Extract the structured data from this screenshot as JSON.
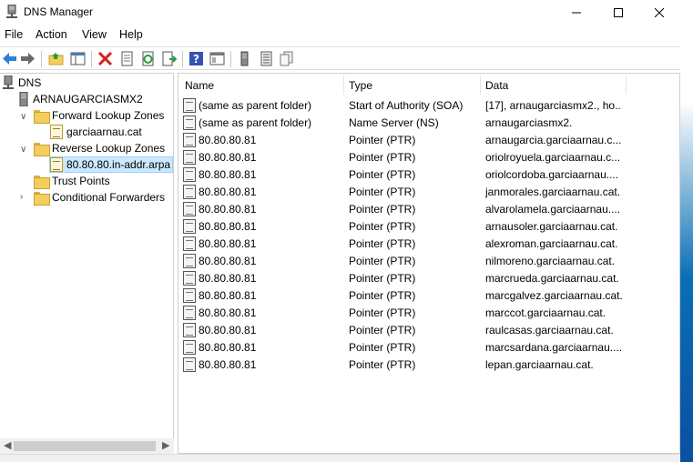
{
  "window": {
    "title": "DNS Manager"
  },
  "menu": [
    "File",
    "Action",
    "View",
    "Help"
  ],
  "toolbar_icons": [
    "back-icon",
    "forward-icon",
    "up-folder-icon",
    "show-hide-tree-icon",
    "delete-icon",
    "properties-icon",
    "refresh-icon",
    "export-icon",
    "help-icon",
    "mmc-icon",
    "server-icon",
    "list-icon",
    "copy-icon"
  ],
  "tree": {
    "root": "DNS",
    "server": "ARNAUGARCIASMX2",
    "forward": "Forward Lookup Zones",
    "forward_zone": "garciaarnau.cat",
    "reverse": "Reverse Lookup Zones",
    "reverse_zone": "80.80.80.in-addr.arpa",
    "trust": "Trust Points",
    "conditional": "Conditional Forwarders"
  },
  "columns": {
    "name": "Name",
    "type": "Type",
    "data": "Data"
  },
  "records": [
    {
      "name": "(same as parent folder)",
      "type": "Start of Authority (SOA)",
      "data": "[17], arnaugarciasmx2., ho..."
    },
    {
      "name": "(same as parent folder)",
      "type": "Name Server (NS)",
      "data": "arnaugarciasmx2."
    },
    {
      "name": "80.80.80.81",
      "type": "Pointer (PTR)",
      "data": "arnaugarcia.garciaarnau.c..."
    },
    {
      "name": "80.80.80.81",
      "type": "Pointer (PTR)",
      "data": "oriolroyuela.garciaarnau.c..."
    },
    {
      "name": "80.80.80.81",
      "type": "Pointer (PTR)",
      "data": "oriolcordoba.garciaarnau...."
    },
    {
      "name": "80.80.80.81",
      "type": "Pointer (PTR)",
      "data": "janmorales.garciaarnau.cat."
    },
    {
      "name": "80.80.80.81",
      "type": "Pointer (PTR)",
      "data": "alvarolamela.garciaarnau...."
    },
    {
      "name": "80.80.80.81",
      "type": "Pointer (PTR)",
      "data": "arnausoler.garciaarnau.cat."
    },
    {
      "name": "80.80.80.81",
      "type": "Pointer (PTR)",
      "data": "alexroman.garciaarnau.cat."
    },
    {
      "name": "80.80.80.81",
      "type": "Pointer (PTR)",
      "data": "nilmoreno.garciaarnau.cat."
    },
    {
      "name": "80.80.80.81",
      "type": "Pointer (PTR)",
      "data": "marcrueda.garciaarnau.cat."
    },
    {
      "name": "80.80.80.81",
      "type": "Pointer (PTR)",
      "data": "marcgalvez.garciaarnau.cat."
    },
    {
      "name": "80.80.80.81",
      "type": "Pointer (PTR)",
      "data": "marccot.garciaarnau.cat."
    },
    {
      "name": "80.80.80.81",
      "type": "Pointer (PTR)",
      "data": "raulcasas.garciaarnau.cat."
    },
    {
      "name": "80.80.80.81",
      "type": "Pointer (PTR)",
      "data": "marcsardana.garciaarnau...."
    },
    {
      "name": "80.80.80.81",
      "type": "Pointer (PTR)",
      "data": "lepan.garciaarnau.cat."
    }
  ]
}
